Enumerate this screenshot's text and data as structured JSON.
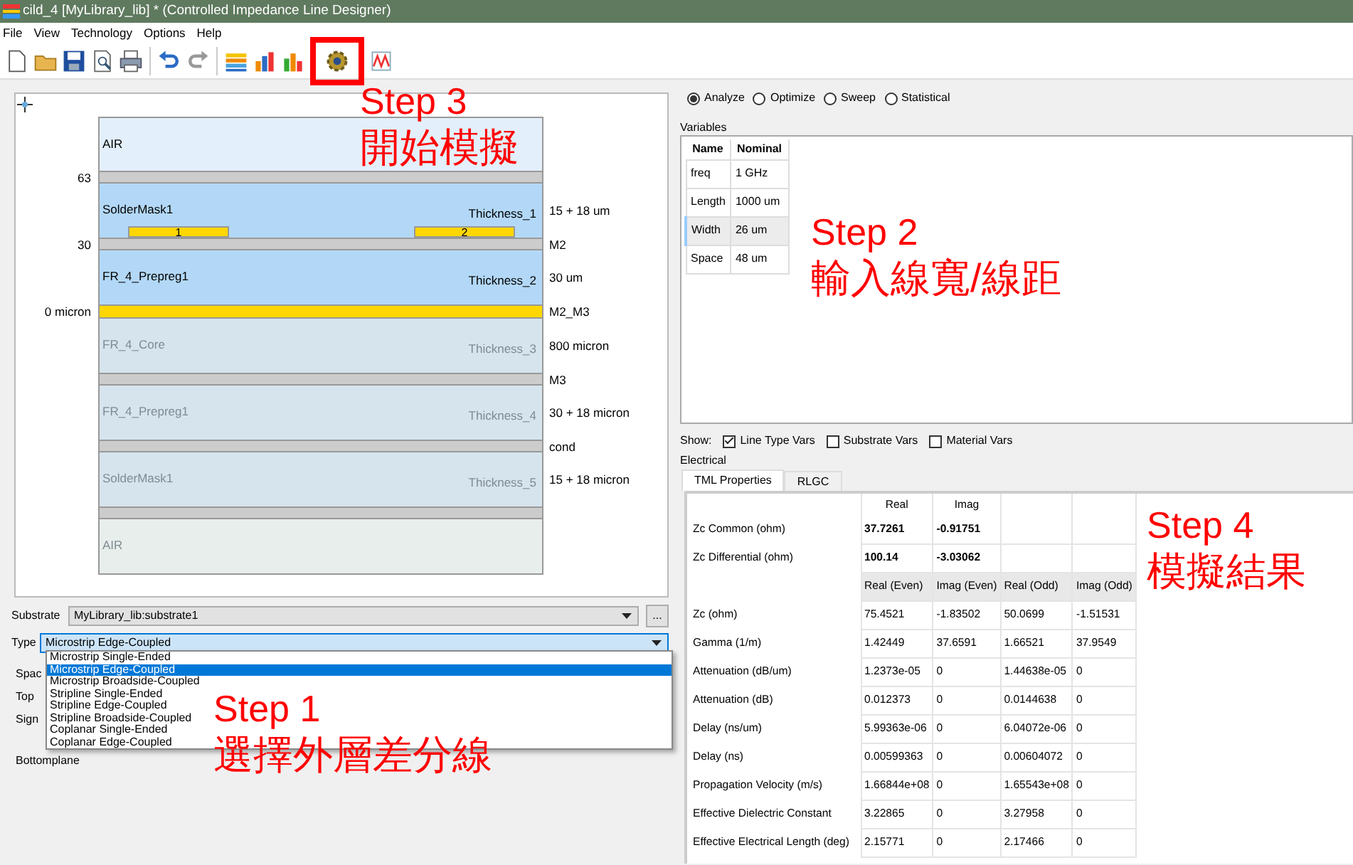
{
  "window": {
    "title": "cild_4 [MyLibrary_lib] * (Controlled Impedance Line Designer)"
  },
  "menu": [
    "File",
    "View",
    "Technology",
    "Options",
    "Help"
  ],
  "toolbar": [
    {
      "kind": "new",
      "highlighted": false
    },
    {
      "kind": "open",
      "highlighted": false
    },
    {
      "kind": "save",
      "highlighted": false
    },
    {
      "kind": "preview",
      "highlighted": false
    },
    {
      "kind": "print",
      "highlighted": false
    },
    {
      "kind": "separator"
    },
    {
      "kind": "undo",
      "highlighted": false
    },
    {
      "kind": "redo",
      "highlighted": false
    },
    {
      "kind": "separator"
    },
    {
      "kind": "stack",
      "highlighted": false
    },
    {
      "kind": "bars",
      "highlighted": false
    },
    {
      "kind": "chart",
      "highlighted": false
    },
    {
      "kind": "gear",
      "highlighted": true
    },
    {
      "kind": "graph",
      "highlighted": false
    }
  ],
  "stackup": {
    "layers": [
      {
        "kind": "dielectric",
        "name": "AIR",
        "color": "#e3effa",
        "disabled": false
      },
      {
        "kind": "separator",
        "color": "#cccccc",
        "left_label": "63"
      },
      {
        "kind": "dielectric",
        "name": "SolderMask1",
        "thickness": "Thickness_1",
        "right_label": "15 + 18 um",
        "color": "#b3d8f7",
        "disabled": false,
        "traces": [
          {
            "label": "1"
          },
          {
            "label": "2"
          }
        ]
      },
      {
        "kind": "separator",
        "color": "#cccccc",
        "left_label": "30",
        "right_label": "M2"
      },
      {
        "kind": "dielectric",
        "name": "FR_4_Prepreg1",
        "thickness": "Thickness_2",
        "right_label": "30 um",
        "color": "#b3d8f7",
        "disabled": false
      },
      {
        "kind": "plane",
        "color": "#ffd700",
        "left_label": "0 micron",
        "right_label": "M2_M3"
      },
      {
        "kind": "dielectric",
        "name": "FR_4_Core",
        "thickness": "Thickness_3",
        "right_label": "800 micron",
        "color": "#d6e4ee",
        "disabled": true
      },
      {
        "kind": "separator",
        "color": "#cccccc",
        "right_label": "M3"
      },
      {
        "kind": "dielectric",
        "name": "FR_4_Prepreg1",
        "thickness": "Thickness_4",
        "right_label": "30 + 18 micron",
        "color": "#d6e4ee",
        "disabled": true
      },
      {
        "kind": "separator",
        "color": "#cccccc",
        "right_label": "cond"
      },
      {
        "kind": "dielectric",
        "name": "SolderMask1",
        "thickness": "Thickness_5",
        "right_label": "15 + 18 micron",
        "color": "#d6e4ee",
        "disabled": true
      },
      {
        "kind": "separator",
        "color": "#cccccc"
      },
      {
        "kind": "dielectric",
        "name": "AIR",
        "color": "#e8eeeb",
        "disabled": true
      }
    ]
  },
  "substrate": {
    "label": "Substrate",
    "value": "MyLibrary_lib:substrate1",
    "browse": "..."
  },
  "line_type": {
    "label": "Type",
    "value": "Microstrip Edge-Coupled",
    "expanded": true,
    "options": [
      {
        "label": "Microstrip Single-Ended",
        "selected": false
      },
      {
        "label": "Microstrip Edge-Coupled",
        "selected": true
      },
      {
        "label": "Microstrip Broadside-Coupled",
        "selected": false
      },
      {
        "label": "Stripline Single-Ended",
        "selected": false
      },
      {
        "label": "Stripline Edge-Coupled",
        "selected": false
      },
      {
        "label": "Stripline Broadside-Coupled",
        "selected": false
      },
      {
        "label": "Coplanar Single-Ended",
        "selected": false
      },
      {
        "label": "Coplanar Edge-Coupled",
        "selected": false
      }
    ]
  },
  "covered_fields": [
    "Spac",
    "Top",
    "Sign",
    "Bottomplane"
  ],
  "modes": [
    {
      "label": "Analyze",
      "selected": true
    },
    {
      "label": "Optimize",
      "selected": false
    },
    {
      "label": "Sweep",
      "selected": false
    },
    {
      "label": "Statistical",
      "selected": false
    }
  ],
  "variables": {
    "title": "Variables",
    "columns": [
      "Name",
      "Nominal"
    ],
    "rows": [
      {
        "name": "freq",
        "nominal": "1 GHz",
        "selected": false
      },
      {
        "name": "Length",
        "nominal": "1000 um",
        "selected": false
      },
      {
        "name": "Width",
        "nominal": "26 um",
        "selected": true
      },
      {
        "name": "Space",
        "nominal": "48 um",
        "selected": false
      }
    ]
  },
  "show": {
    "label": "Show:",
    "options": [
      {
        "label": "Line Type Vars",
        "checked": true
      },
      {
        "label": "Substrate Vars",
        "checked": false
      },
      {
        "label": "Material Vars",
        "checked": false
      }
    ]
  },
  "electrical": {
    "title": "Electrical",
    "tabs": [
      {
        "label": "TML Properties",
        "selected": true
      },
      {
        "label": "RLGC",
        "selected": false
      }
    ],
    "rows": [
      {
        "kind": "header",
        "cells": [
          "",
          "Real",
          "Imag",
          "",
          ""
        ]
      },
      {
        "kind": "summary",
        "cells": [
          "Zc Common (ohm)",
          "37.7261",
          "-0.91751",
          "",
          ""
        ]
      },
      {
        "kind": "summary",
        "cells": [
          "Zc Differential (ohm)",
          "100.14",
          "-3.03062",
          "",
          ""
        ]
      },
      {
        "kind": "subheader",
        "cells": [
          "",
          "Real (Even)",
          "Imag (Even)",
          "Real (Odd)",
          "Imag (Odd)"
        ]
      },
      {
        "kind": "value",
        "cells": [
          "Zc (ohm)",
          "75.4521",
          "-1.83502",
          "50.0699",
          "-1.51531"
        ]
      },
      {
        "kind": "value",
        "cells": [
          "Gamma (1/m)",
          "1.42449",
          "37.6591",
          "1.66521",
          "37.9549"
        ]
      },
      {
        "kind": "value",
        "cells": [
          "Attenuation (dB/um)",
          "1.2373e-05",
          "0",
          "1.44638e-05",
          "0"
        ]
      },
      {
        "kind": "value",
        "cells": [
          "Attenuation (dB)",
          "0.012373",
          "0",
          "0.0144638",
          "0"
        ]
      },
      {
        "kind": "value",
        "cells": [
          "Delay (ns/um)",
          "5.99363e-06",
          "0",
          "6.04072e-06",
          "0"
        ]
      },
      {
        "kind": "value",
        "cells": [
          "Delay (ns)",
          "0.00599363",
          "0",
          "0.00604072",
          "0"
        ]
      },
      {
        "kind": "value",
        "cells": [
          "Propagation Velocity (m/s)",
          "1.66844e+08",
          "0",
          "1.65543e+08",
          "0"
        ]
      },
      {
        "kind": "value",
        "cells": [
          "Effective Dielectric Constant",
          "3.22865",
          "0",
          "3.27958",
          "0"
        ]
      },
      {
        "kind": "value",
        "cells": [
          "Effective Electrical Length (deg)",
          "2.15771",
          "0",
          "2.17466",
          "0"
        ]
      }
    ]
  },
  "annotations": [
    {
      "step": "Step 3",
      "caption": "開始模擬"
    },
    {
      "step": "Step 2",
      "caption": "輸入線寬/線距"
    },
    {
      "step": "Step 4",
      "caption": "模擬結果"
    },
    {
      "step": "Step 1",
      "caption": "選擇外層差分線"
    }
  ]
}
